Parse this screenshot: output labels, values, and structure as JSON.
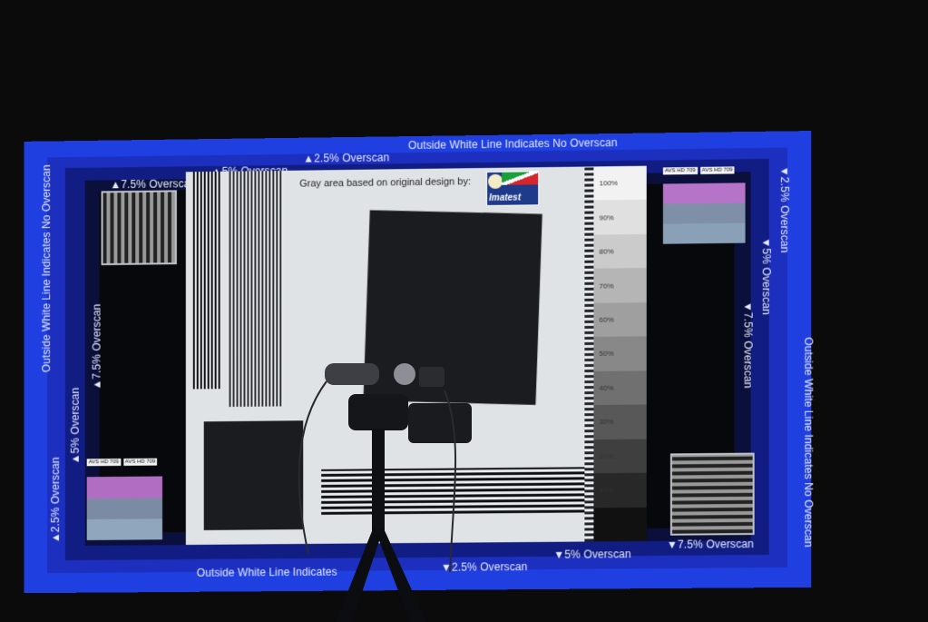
{
  "pattern": {
    "top_no_overscan": "Outside White Line Indicates No Overscan",
    "bottom_no_overscan": "Outside White Line Indicates",
    "left_no_overscan": "Outside White Line Indicates No Overscan",
    "right_no_overscan": "Outside White Line Indicates No Overscan",
    "overscan_2_5_top": "▲2.5% Overscan",
    "overscan_5_top": "▲5% Overscan",
    "overscan_7_5_top": "▲7.5% Overscan",
    "overscan_7_5_left": "▲7.5% Overscan",
    "overscan_5_left": "▲5% Overscan",
    "overscan_2_5_left": "▲2.5% Overscan",
    "overscan_2_5_right": "▼2.5% Overscan",
    "overscan_5_right": "▼5% Overscan",
    "overscan_7_5_right": "▼7.5% Overscan",
    "overscan_2_5_bottom": "▼2.5% Overscan",
    "overscan_5_bottom": "▼5% Overscan",
    "overscan_7_5_bottom": "▼7.5% Overscan",
    "gray_area_title": "Gray area based on original design by:",
    "logo_text": "Imatest",
    "avs_tag": "AVS HD 709"
  },
  "grayscale_labels": [
    "100%",
    "90%",
    "80%",
    "70%",
    "60%",
    "50%",
    "40%",
    "30%",
    "20%",
    "10%",
    ""
  ],
  "colors": {
    "outer_blue": "#1f3fe0",
    "mid_blue": "#1c2fbf",
    "inner_blue": "#111d82",
    "gray_area": "#dfe3e6",
    "background": "#0b0b0c"
  }
}
